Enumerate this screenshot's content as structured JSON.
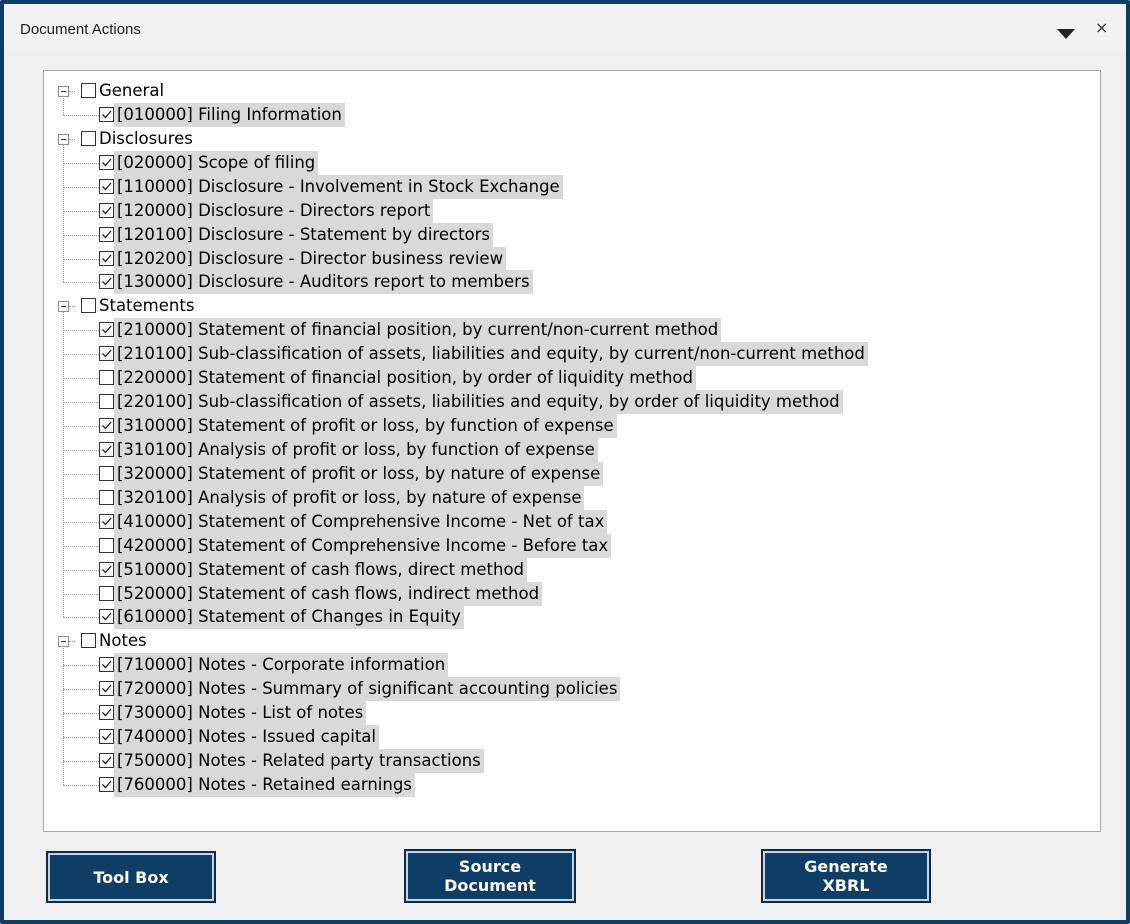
{
  "window": {
    "title": "Document Actions",
    "menu_icon": "dropdown-triangle-icon",
    "close_label": "×"
  },
  "tree": [
    {
      "label": "General",
      "checked": false,
      "children": [
        {
          "label": "[010000] Filing Information",
          "checked": true
        }
      ]
    },
    {
      "label": "Disclosures",
      "checked": false,
      "children": [
        {
          "label": "[020000] Scope of filing",
          "checked": true
        },
        {
          "label": "[110000] Disclosure - Involvement in Stock Exchange",
          "checked": true
        },
        {
          "label": "[120000] Disclosure - Directors report",
          "checked": true
        },
        {
          "label": "[120100] Disclosure - Statement by directors",
          "checked": true
        },
        {
          "label": "[120200] Disclosure - Director business review",
          "checked": true
        },
        {
          "label": "[130000] Disclosure - Auditors report to members",
          "checked": true
        }
      ]
    },
    {
      "label": "Statements",
      "checked": false,
      "children": [
        {
          "label": "[210000] Statement of financial position, by current/non-current method",
          "checked": true
        },
        {
          "label": "[210100] Sub-classification of assets, liabilities and equity, by current/non-current method",
          "checked": true
        },
        {
          "label": "[220000] Statement of financial position, by order of liquidity method",
          "checked": false
        },
        {
          "label": "[220100] Sub-classification of assets, liabilities and equity, by order of liquidity method",
          "checked": false
        },
        {
          "label": "[310000] Statement of profit or loss, by function of expense",
          "checked": true
        },
        {
          "label": "[310100] Analysis of profit or loss, by function of expense",
          "checked": true
        },
        {
          "label": "[320000] Statement of profit or loss, by nature of expense",
          "checked": false
        },
        {
          "label": "[320100] Analysis of profit or loss, by nature of expense",
          "checked": false
        },
        {
          "label": "[410000] Statement of Comprehensive Income - Net of tax",
          "checked": true
        },
        {
          "label": "[420000] Statement of Comprehensive Income - Before tax",
          "checked": false
        },
        {
          "label": "[510000] Statement of cash flows, direct method",
          "checked": true
        },
        {
          "label": "[520000] Statement of cash flows, indirect method",
          "checked": false
        },
        {
          "label": "[610000] Statement of Changes in Equity",
          "checked": true
        }
      ]
    },
    {
      "label": "Notes",
      "checked": false,
      "children": [
        {
          "label": "[710000] Notes - Corporate information",
          "checked": true
        },
        {
          "label": "[720000] Notes - Summary of significant accounting policies",
          "checked": true
        },
        {
          "label": "[730000] Notes - List of notes",
          "checked": true
        },
        {
          "label": "[740000] Notes - Issued capital",
          "checked": true
        },
        {
          "label": "[750000] Notes - Related party transactions",
          "checked": true
        },
        {
          "label": "[760000] Notes - Retained earnings",
          "checked": true
        }
      ]
    }
  ],
  "buttons": {
    "toolbox": "Tool Box",
    "source_document": "Source\nDocument",
    "generate_xbrl": "Generate\nXBRL"
  },
  "colors": {
    "accent": "#0e3d66",
    "leaf_highlight": "#d9d9d9"
  }
}
